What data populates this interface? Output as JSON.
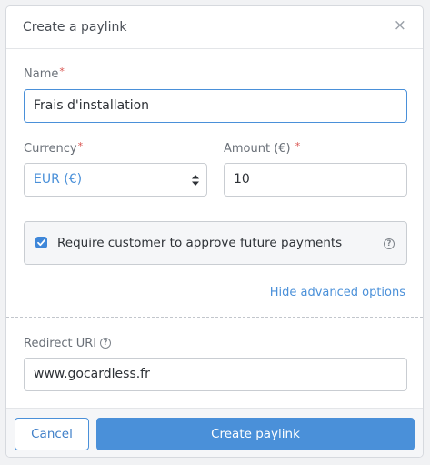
{
  "dialog": {
    "title": "Create a paylink",
    "close_icon": "×"
  },
  "form": {
    "name": {
      "label": "Name",
      "required_mark": "*",
      "value": "Frais d'installation"
    },
    "currency": {
      "label": "Currency",
      "required_mark": "*",
      "value": "EUR (€)"
    },
    "amount": {
      "label": "Amount (€)",
      "required_mark": "*",
      "value": "10"
    },
    "approval": {
      "checked": true,
      "label": "Require customer to approve future payments",
      "help_icon": "?"
    },
    "advanced_link": "Hide advanced options",
    "redirect_uri": {
      "label": "Redirect URI",
      "help_icon": "?",
      "value": "www.gocardless.fr"
    }
  },
  "footer": {
    "cancel_label": "Cancel",
    "submit_label": "Create paylink"
  },
  "colors": {
    "accent": "#4a90d9",
    "required": "#d9534f"
  }
}
